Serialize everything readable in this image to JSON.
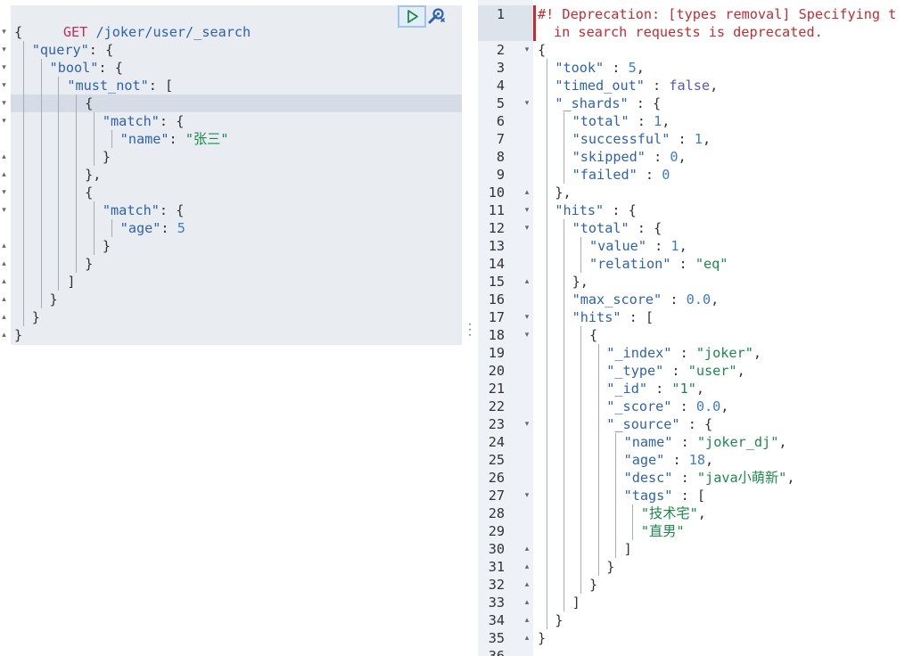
{
  "request": {
    "method": "GET",
    "url": " /joker/user/_search",
    "lines": [
      {
        "indent": 0,
        "parts": [
          [
            "p",
            "{"
          ]
        ],
        "fold": "down"
      },
      {
        "indent": 1,
        "parts": [
          [
            "k",
            "\"query\""
          ],
          [
            "p",
            ": {"
          ]
        ],
        "fold": "down"
      },
      {
        "indent": 2,
        "parts": [
          [
            "k",
            "\"bool\""
          ],
          [
            "p",
            ": {"
          ]
        ],
        "fold": "down"
      },
      {
        "indent": 3,
        "parts": [
          [
            "k",
            "\"must_not\""
          ],
          [
            "p",
            ": ["
          ]
        ],
        "fold": "down"
      },
      {
        "indent": 4,
        "parts": [
          [
            "p",
            "{"
          ]
        ],
        "fold": "down"
      },
      {
        "indent": 5,
        "parts": [
          [
            "k",
            "\"match\""
          ],
          [
            "p",
            ": {"
          ]
        ],
        "fold": "down"
      },
      {
        "indent": 6,
        "parts": [
          [
            "k",
            "\"name\""
          ],
          [
            "p",
            ": "
          ],
          [
            "s",
            "\"张三\""
          ]
        ],
        "fold": ""
      },
      {
        "indent": 5,
        "parts": [
          [
            "p",
            "}"
          ]
        ],
        "fold": "up"
      },
      {
        "indent": 4,
        "parts": [
          [
            "p",
            "},"
          ]
        ],
        "fold": "up"
      },
      {
        "indent": 4,
        "parts": [
          [
            "p",
            "{"
          ]
        ],
        "fold": "down"
      },
      {
        "indent": 5,
        "parts": [
          [
            "k",
            "\"match\""
          ],
          [
            "p",
            ": {"
          ]
        ],
        "fold": "down"
      },
      {
        "indent": 6,
        "parts": [
          [
            "k",
            "\"age\""
          ],
          [
            "p",
            ": "
          ],
          [
            "n",
            "5"
          ]
        ],
        "fold": ""
      },
      {
        "indent": 5,
        "parts": [
          [
            "p",
            "}"
          ]
        ],
        "fold": "up"
      },
      {
        "indent": 4,
        "parts": [
          [
            "p",
            "}"
          ]
        ],
        "fold": "up"
      },
      {
        "indent": 3,
        "parts": [
          [
            "p",
            "]"
          ]
        ],
        "fold": "up"
      },
      {
        "indent": 2,
        "parts": [
          [
            "p",
            "}"
          ]
        ],
        "fold": "up"
      },
      {
        "indent": 1,
        "parts": [
          [
            "p",
            "}"
          ]
        ],
        "fold": "up"
      },
      {
        "indent": 0,
        "parts": [
          [
            "p",
            "}"
          ]
        ],
        "fold": "up"
      }
    ]
  },
  "response": {
    "warning_line1": "#! Deprecation: [types removal] Specifying t",
    "warning_line2": "in search requests is deprecated.",
    "line_numbers": [
      "1",
      "2",
      "3",
      "4",
      "5",
      "6",
      "7",
      "8",
      "9",
      "10",
      "11",
      "12",
      "13",
      "14",
      "15",
      "16",
      "17",
      "18",
      "19",
      "20",
      "21",
      "22",
      "23",
      "24",
      "25",
      "26",
      "27",
      "28",
      "29",
      "30",
      "31",
      "32",
      "33",
      "34",
      "35",
      "36"
    ],
    "lines": [
      {
        "n": "2",
        "indent": 0,
        "parts": [
          [
            "p",
            "{"
          ]
        ],
        "fold": "down"
      },
      {
        "n": "3",
        "indent": 1,
        "parts": [
          [
            "k",
            "\"took\""
          ],
          [
            "p",
            " : "
          ],
          [
            "n",
            "5"
          ],
          [
            "p",
            ","
          ]
        ],
        "fold": ""
      },
      {
        "n": "4",
        "indent": 1,
        "parts": [
          [
            "k",
            "\"timed_out\""
          ],
          [
            "p",
            " : "
          ],
          [
            "b",
            "false"
          ],
          [
            "p",
            ","
          ]
        ],
        "fold": ""
      },
      {
        "n": "5",
        "indent": 1,
        "parts": [
          [
            "k",
            "\"_shards\""
          ],
          [
            "p",
            " : {"
          ]
        ],
        "fold": "down"
      },
      {
        "n": "6",
        "indent": 2,
        "parts": [
          [
            "k",
            "\"total\""
          ],
          [
            "p",
            " : "
          ],
          [
            "n",
            "1"
          ],
          [
            "p",
            ","
          ]
        ],
        "fold": ""
      },
      {
        "n": "7",
        "indent": 2,
        "parts": [
          [
            "k",
            "\"successful\""
          ],
          [
            "p",
            " : "
          ],
          [
            "n",
            "1"
          ],
          [
            "p",
            ","
          ]
        ],
        "fold": ""
      },
      {
        "n": "8",
        "indent": 2,
        "parts": [
          [
            "k",
            "\"skipped\""
          ],
          [
            "p",
            " : "
          ],
          [
            "n",
            "0"
          ],
          [
            "p",
            ","
          ]
        ],
        "fold": ""
      },
      {
        "n": "9",
        "indent": 2,
        "parts": [
          [
            "k",
            "\"failed\""
          ],
          [
            "p",
            " : "
          ],
          [
            "n",
            "0"
          ]
        ],
        "fold": ""
      },
      {
        "n": "10",
        "indent": 1,
        "parts": [
          [
            "p",
            "},"
          ]
        ],
        "fold": "up"
      },
      {
        "n": "11",
        "indent": 1,
        "parts": [
          [
            "k",
            "\"hits\""
          ],
          [
            "p",
            " : {"
          ]
        ],
        "fold": "down"
      },
      {
        "n": "12",
        "indent": 2,
        "parts": [
          [
            "k",
            "\"total\""
          ],
          [
            "p",
            " : {"
          ]
        ],
        "fold": "down"
      },
      {
        "n": "13",
        "indent": 3,
        "parts": [
          [
            "k",
            "\"value\""
          ],
          [
            "p",
            " : "
          ],
          [
            "n",
            "1"
          ],
          [
            "p",
            ","
          ]
        ],
        "fold": ""
      },
      {
        "n": "14",
        "indent": 3,
        "parts": [
          [
            "k",
            "\"relation\""
          ],
          [
            "p",
            " : "
          ],
          [
            "s",
            "\"eq\""
          ]
        ],
        "fold": ""
      },
      {
        "n": "15",
        "indent": 2,
        "parts": [
          [
            "p",
            "},"
          ]
        ],
        "fold": "up"
      },
      {
        "n": "16",
        "indent": 2,
        "parts": [
          [
            "k",
            "\"max_score\""
          ],
          [
            "p",
            " : "
          ],
          [
            "n",
            "0.0"
          ],
          [
            "p",
            ","
          ]
        ],
        "fold": ""
      },
      {
        "n": "17",
        "indent": 2,
        "parts": [
          [
            "k",
            "\"hits\""
          ],
          [
            "p",
            " : ["
          ]
        ],
        "fold": "down"
      },
      {
        "n": "18",
        "indent": 3,
        "parts": [
          [
            "p",
            "{"
          ]
        ],
        "fold": "down"
      },
      {
        "n": "19",
        "indent": 4,
        "parts": [
          [
            "k",
            "\"_index\""
          ],
          [
            "p",
            " : "
          ],
          [
            "s",
            "\"joker\""
          ],
          [
            "p",
            ","
          ]
        ],
        "fold": ""
      },
      {
        "n": "20",
        "indent": 4,
        "parts": [
          [
            "k",
            "\"_type\""
          ],
          [
            "p",
            " : "
          ],
          [
            "s",
            "\"user\""
          ],
          [
            "p",
            ","
          ]
        ],
        "fold": ""
      },
      {
        "n": "21",
        "indent": 4,
        "parts": [
          [
            "k",
            "\"_id\""
          ],
          [
            "p",
            " : "
          ],
          [
            "s",
            "\"1\""
          ],
          [
            "p",
            ","
          ]
        ],
        "fold": ""
      },
      {
        "n": "22",
        "indent": 4,
        "parts": [
          [
            "k",
            "\"_score\""
          ],
          [
            "p",
            " : "
          ],
          [
            "n",
            "0.0"
          ],
          [
            "p",
            ","
          ]
        ],
        "fold": ""
      },
      {
        "n": "23",
        "indent": 4,
        "parts": [
          [
            "k",
            "\"_source\""
          ],
          [
            "p",
            " : {"
          ]
        ],
        "fold": "down"
      },
      {
        "n": "24",
        "indent": 5,
        "parts": [
          [
            "k",
            "\"name\""
          ],
          [
            "p",
            " : "
          ],
          [
            "s",
            "\"joker_dj\""
          ],
          [
            "p",
            ","
          ]
        ],
        "fold": ""
      },
      {
        "n": "25",
        "indent": 5,
        "parts": [
          [
            "k",
            "\"age\""
          ],
          [
            "p",
            " : "
          ],
          [
            "n",
            "18"
          ],
          [
            "p",
            ","
          ]
        ],
        "fold": ""
      },
      {
        "n": "26",
        "indent": 5,
        "parts": [
          [
            "k",
            "\"desc\""
          ],
          [
            "p",
            " : "
          ],
          [
            "s",
            "\"java小萌新\""
          ],
          [
            "p",
            ","
          ]
        ],
        "fold": ""
      },
      {
        "n": "27",
        "indent": 5,
        "parts": [
          [
            "k",
            "\"tags\""
          ],
          [
            "p",
            " : ["
          ]
        ],
        "fold": "down"
      },
      {
        "n": "28",
        "indent": 6,
        "parts": [
          [
            "s",
            "\"技术宅\""
          ],
          [
            "p",
            ","
          ]
        ],
        "fold": ""
      },
      {
        "n": "29",
        "indent": 6,
        "parts": [
          [
            "s",
            "\"直男\""
          ]
        ],
        "fold": ""
      },
      {
        "n": "30",
        "indent": 5,
        "parts": [
          [
            "p",
            "]"
          ]
        ],
        "fold": "up"
      },
      {
        "n": "31",
        "indent": 4,
        "parts": [
          [
            "p",
            "}"
          ]
        ],
        "fold": "up"
      },
      {
        "n": "32",
        "indent": 3,
        "parts": [
          [
            "p",
            "}"
          ]
        ],
        "fold": "up"
      },
      {
        "n": "33",
        "indent": 2,
        "parts": [
          [
            "p",
            "]"
          ]
        ],
        "fold": "up"
      },
      {
        "n": "34",
        "indent": 1,
        "parts": [
          [
            "p",
            "}"
          ]
        ],
        "fold": "up"
      },
      {
        "n": "35",
        "indent": 0,
        "parts": [
          [
            "p",
            "}"
          ]
        ],
        "fold": "up"
      }
    ]
  },
  "icons": {
    "run": "play-icon",
    "settings": "wrench-icon",
    "divider": "vertical-dots-icon"
  },
  "colors": {
    "method": "#c52b5a",
    "key": "#2f62b0",
    "string": "#1c8a4a",
    "number": "#3a7bd5",
    "warning": "#c52b32",
    "editor_bg": "#e9ecf1"
  }
}
